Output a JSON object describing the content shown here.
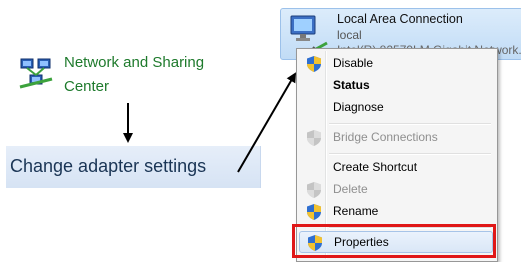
{
  "network_sharing": {
    "line1": "Network and Sharing",
    "line2": "Center"
  },
  "change_adapter": {
    "label": "Change adapter settings"
  },
  "connection": {
    "name": "Local Area Connection",
    "network": "local",
    "device": "Intel(R) 82579LM Gigabit Network..."
  },
  "context_menu": {
    "disable": "Disable",
    "status": "Status",
    "diagnose": "Diagnose",
    "bridge": "Bridge Connections",
    "create_shortcut": "Create Shortcut",
    "delete": "Delete",
    "rename": "Rename",
    "properties": "Properties"
  },
  "colors": {
    "link_green": "#1e7a2c",
    "highlight_red": "#e01818",
    "selection_blue": "#dae7f7"
  },
  "icons": {
    "network_center": "network-sharing-center-icon",
    "connection": "network-adapter-icon",
    "shield": "uac-shield-icon"
  }
}
